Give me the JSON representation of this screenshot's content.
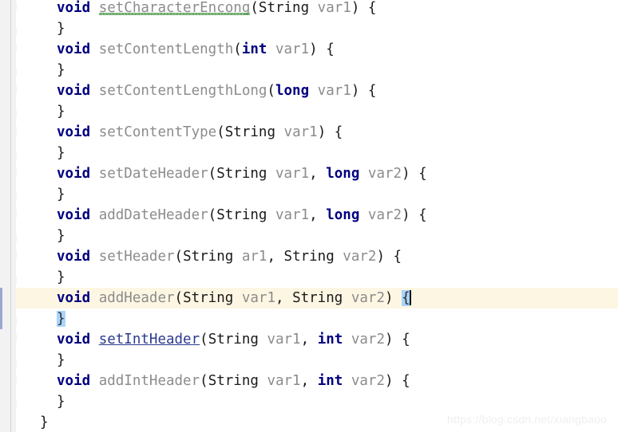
{
  "editor": {
    "watermark": "https://blog.csdn.net/xiangbaoo",
    "colors": {
      "background": "#ffffff",
      "gutter": "#f2f2f2",
      "keyword": "#000080",
      "identifier": "#8c8c8c",
      "plain": "#1a1a1a",
      "caret_line": "#fdf6e3",
      "brace_match": "#a8d4fb",
      "change_marker": "#9aa7d0",
      "hyperlink": "#2b3a8f",
      "typo_squiggle": "#4f9b4f"
    },
    "caret": {
      "line": 17,
      "column_after": "{"
    },
    "lines": [
      {
        "n": 1,
        "indent": 0,
        "segments": [
          {
            "t": "void",
            "c": "kw"
          },
          {
            "t": " ",
            "c": "plain"
          },
          {
            "t": "setCharacterEncong",
            "c": "typo"
          },
          {
            "t": "(",
            "c": "plain"
          },
          {
            "t": "String",
            "c": "plain"
          },
          {
            "t": " ",
            "c": "plain"
          },
          {
            "t": "var1",
            "c": "gray"
          },
          {
            "t": ") {",
            "c": "plain"
          }
        ]
      },
      {
        "n": 2,
        "indent": 0,
        "segments": [
          {
            "t": "}",
            "c": "plain"
          }
        ]
      },
      {
        "n": 3,
        "indent": 0,
        "segments": [
          {
            "t": "void",
            "c": "kw"
          },
          {
            "t": " ",
            "c": "plain"
          },
          {
            "t": "setContentLength",
            "c": "gray"
          },
          {
            "t": "(",
            "c": "plain"
          },
          {
            "t": "int",
            "c": "kw"
          },
          {
            "t": " ",
            "c": "plain"
          },
          {
            "t": "var1",
            "c": "gray"
          },
          {
            "t": ") {",
            "c": "plain"
          }
        ]
      },
      {
        "n": 4,
        "indent": 0,
        "segments": [
          {
            "t": "}",
            "c": "plain"
          }
        ]
      },
      {
        "n": 5,
        "indent": 0,
        "segments": [
          {
            "t": "void",
            "c": "kw"
          },
          {
            "t": " ",
            "c": "plain"
          },
          {
            "t": "setContentLengthLong",
            "c": "gray"
          },
          {
            "t": "(",
            "c": "plain"
          },
          {
            "t": "long",
            "c": "kw"
          },
          {
            "t": " ",
            "c": "plain"
          },
          {
            "t": "var1",
            "c": "gray"
          },
          {
            "t": ") {",
            "c": "plain"
          }
        ]
      },
      {
        "n": 6,
        "indent": 0,
        "segments": [
          {
            "t": "}",
            "c": "plain"
          }
        ]
      },
      {
        "n": 7,
        "indent": 0,
        "segments": [
          {
            "t": "void",
            "c": "kw"
          },
          {
            "t": " ",
            "c": "plain"
          },
          {
            "t": "setContentType",
            "c": "gray"
          },
          {
            "t": "(",
            "c": "plain"
          },
          {
            "t": "String",
            "c": "plain"
          },
          {
            "t": " ",
            "c": "plain"
          },
          {
            "t": "var1",
            "c": "gray"
          },
          {
            "t": ") {",
            "c": "plain"
          }
        ]
      },
      {
        "n": 8,
        "indent": 0,
        "segments": [
          {
            "t": "}",
            "c": "plain"
          }
        ]
      },
      {
        "n": 9,
        "indent": 0,
        "segments": [
          {
            "t": "void",
            "c": "kw"
          },
          {
            "t": " ",
            "c": "plain"
          },
          {
            "t": "setDateHeader",
            "c": "gray"
          },
          {
            "t": "(",
            "c": "plain"
          },
          {
            "t": "String",
            "c": "plain"
          },
          {
            "t": " ",
            "c": "plain"
          },
          {
            "t": "var1",
            "c": "gray"
          },
          {
            "t": ", ",
            "c": "plain"
          },
          {
            "t": "long",
            "c": "kw"
          },
          {
            "t": " ",
            "c": "plain"
          },
          {
            "t": "var2",
            "c": "gray"
          },
          {
            "t": ") {",
            "c": "plain"
          }
        ]
      },
      {
        "n": 10,
        "indent": 0,
        "segments": [
          {
            "t": "}",
            "c": "plain"
          }
        ]
      },
      {
        "n": 11,
        "indent": 0,
        "segments": [
          {
            "t": "void",
            "c": "kw"
          },
          {
            "t": " ",
            "c": "plain"
          },
          {
            "t": "addDateHeader",
            "c": "gray"
          },
          {
            "t": "(",
            "c": "plain"
          },
          {
            "t": "String",
            "c": "plain"
          },
          {
            "t": " ",
            "c": "plain"
          },
          {
            "t": "var1",
            "c": "gray"
          },
          {
            "t": ", ",
            "c": "plain"
          },
          {
            "t": "long",
            "c": "kw"
          },
          {
            "t": " ",
            "c": "plain"
          },
          {
            "t": "var2",
            "c": "gray"
          },
          {
            "t": ") {",
            "c": "plain"
          }
        ]
      },
      {
        "n": 12,
        "indent": 0,
        "segments": [
          {
            "t": "}",
            "c": "plain"
          }
        ]
      },
      {
        "n": 13,
        "indent": 0,
        "segments": [
          {
            "t": "void",
            "c": "kw"
          },
          {
            "t": " ",
            "c": "plain"
          },
          {
            "t": "setHeader",
            "c": "gray"
          },
          {
            "t": "(",
            "c": "plain"
          },
          {
            "t": "String",
            "c": "plain"
          },
          {
            "t": " ",
            "c": "plain"
          },
          {
            "t": "ar1",
            "c": "gray"
          },
          {
            "t": ", ",
            "c": "plain"
          },
          {
            "t": "String",
            "c": "plain"
          },
          {
            "t": " ",
            "c": "plain"
          },
          {
            "t": "var2",
            "c": "gray"
          },
          {
            "t": ") {",
            "c": "plain"
          }
        ]
      },
      {
        "n": 14,
        "indent": 0,
        "segments": [
          {
            "t": "}",
            "c": "plain"
          }
        ]
      },
      {
        "n": 15,
        "indent": 0,
        "highlight": true,
        "segments": [
          {
            "t": "void",
            "c": "kw"
          },
          {
            "t": " ",
            "c": "plain"
          },
          {
            "t": "addHeader",
            "c": "gray"
          },
          {
            "t": "(",
            "c": "plain"
          },
          {
            "t": "String",
            "c": "plain"
          },
          {
            "t": " ",
            "c": "plain"
          },
          {
            "t": "var1",
            "c": "gray"
          },
          {
            "t": ", ",
            "c": "plain"
          },
          {
            "t": "String",
            "c": "plain"
          },
          {
            "t": " ",
            "c": "plain"
          },
          {
            "t": "var2",
            "c": "gray"
          },
          {
            "t": ") ",
            "c": "plain"
          },
          {
            "t": "{",
            "c": "brace-match"
          },
          {
            "t": "",
            "c": "caret"
          }
        ]
      },
      {
        "n": 16,
        "indent": 0,
        "segments": [
          {
            "t": "}",
            "c": "brace-match"
          }
        ]
      },
      {
        "n": 17,
        "indent": 0,
        "segments": [
          {
            "t": "void",
            "c": "kw"
          },
          {
            "t": " ",
            "c": "plain"
          },
          {
            "t": "setIntHeader",
            "c": "link"
          },
          {
            "t": "(",
            "c": "plain"
          },
          {
            "t": "String",
            "c": "plain"
          },
          {
            "t": " ",
            "c": "plain"
          },
          {
            "t": "var1",
            "c": "gray"
          },
          {
            "t": ", ",
            "c": "plain"
          },
          {
            "t": "int",
            "c": "kw"
          },
          {
            "t": " ",
            "c": "plain"
          },
          {
            "t": "var2",
            "c": "gray"
          },
          {
            "t": ") {",
            "c": "plain"
          }
        ]
      },
      {
        "n": 18,
        "indent": 0,
        "segments": [
          {
            "t": "}",
            "c": "plain"
          }
        ]
      },
      {
        "n": 19,
        "indent": 0,
        "segments": [
          {
            "t": "void",
            "c": "kw"
          },
          {
            "t": " ",
            "c": "plain"
          },
          {
            "t": "addIntHeader",
            "c": "gray"
          },
          {
            "t": "(",
            "c": "plain"
          },
          {
            "t": "String",
            "c": "plain"
          },
          {
            "t": " ",
            "c": "plain"
          },
          {
            "t": "var1",
            "c": "gray"
          },
          {
            "t": ", ",
            "c": "plain"
          },
          {
            "t": "int",
            "c": "kw"
          },
          {
            "t": " ",
            "c": "plain"
          },
          {
            "t": "var2",
            "c": "gray"
          },
          {
            "t": ") {",
            "c": "plain"
          }
        ]
      },
      {
        "n": 20,
        "indent": 0,
        "segments": [
          {
            "t": "}",
            "c": "plain"
          }
        ]
      },
      {
        "n": 21,
        "indent": -1,
        "segments": [
          {
            "t": "}",
            "c": "plain"
          }
        ]
      }
    ],
    "fold_markers": [
      {
        "line": 1,
        "type": "fold-start"
      },
      {
        "line": 2,
        "type": "fold-end"
      },
      {
        "line": 3,
        "type": "fold-start"
      },
      {
        "line": 4,
        "type": "fold-end"
      },
      {
        "line": 5,
        "type": "fold-start"
      },
      {
        "line": 6,
        "type": "fold-end"
      },
      {
        "line": 7,
        "type": "fold-start"
      },
      {
        "line": 8,
        "type": "fold-end"
      },
      {
        "line": 9,
        "type": "fold-start"
      },
      {
        "line": 10,
        "type": "fold-end"
      },
      {
        "line": 11,
        "type": "fold-start"
      },
      {
        "line": 12,
        "type": "fold-end"
      },
      {
        "line": 13,
        "type": "fold-start"
      },
      {
        "line": 14,
        "type": "fold-end"
      },
      {
        "line": 15,
        "type": "fold-start"
      },
      {
        "line": 16,
        "type": "fold-end"
      },
      {
        "line": 17,
        "type": "fold-start"
      },
      {
        "line": 18,
        "type": "fold-end"
      },
      {
        "line": 19,
        "type": "fold-start"
      },
      {
        "line": 20,
        "type": "fold-end"
      }
    ],
    "change_markers": [
      {
        "from_line": 15,
        "to_line": 16
      }
    ]
  }
}
